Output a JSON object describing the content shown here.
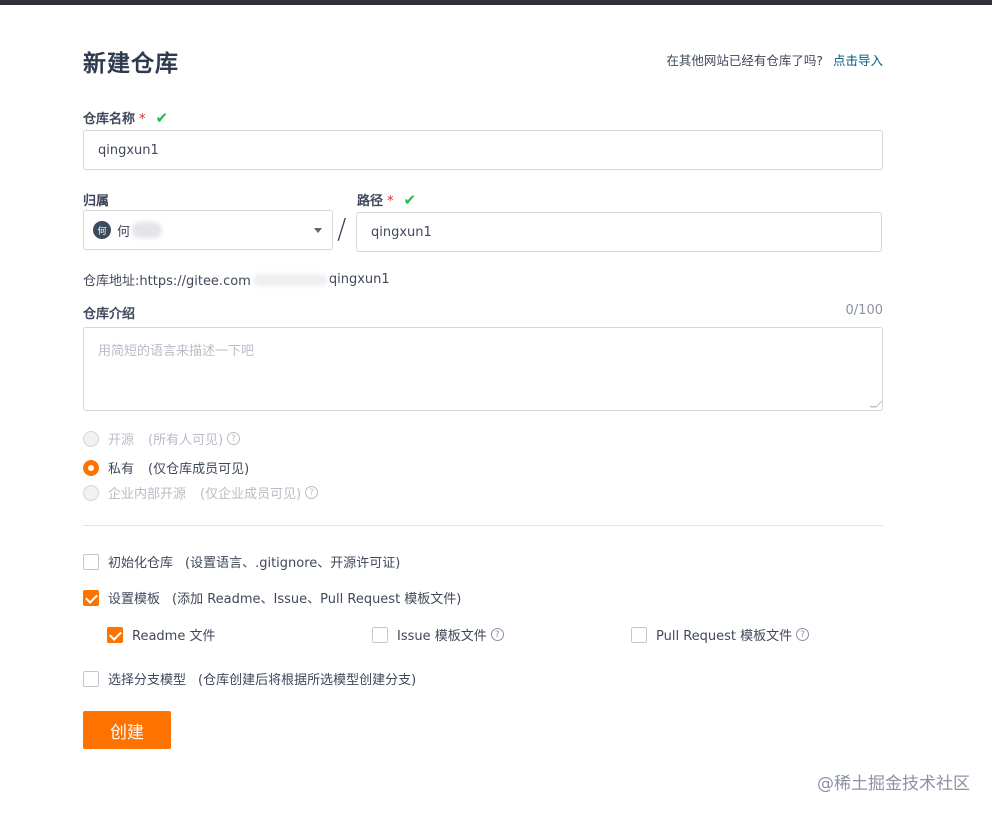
{
  "header": {
    "title": "新建仓库",
    "import_hint": "在其他网站已经有仓库了吗?",
    "import_link": "点击导入"
  },
  "repo_name": {
    "label": "仓库名称",
    "required_mark": "*",
    "valid_mark": "✔",
    "value": "qingxun1"
  },
  "owner": {
    "label": "归属",
    "avatar_text": "何",
    "name": "何"
  },
  "path": {
    "label": "路径",
    "required_mark": "*",
    "valid_mark": "✔",
    "separator": "/",
    "value": "qingxun1"
  },
  "address": {
    "prefix": "仓库地址:https://gitee.com",
    "suffix": "qingxun1"
  },
  "description": {
    "label": "仓库介绍",
    "counter": "0/100",
    "placeholder": "用简短的语言来描述一下吧"
  },
  "visibility": {
    "options": [
      {
        "label": "开源",
        "sub": "(所有人可见)",
        "help": "?"
      },
      {
        "label": "私有",
        "sub": "(仅仓库成员可见)",
        "help": ""
      },
      {
        "label": "企业内部开源",
        "sub": "(仅企业成员可见)",
        "help": "?"
      }
    ],
    "selected_index": 1
  },
  "options": {
    "init": {
      "label": "初始化仓库",
      "sub": "(设置语言、.gitignore、开源许可证)",
      "checked": false
    },
    "template": {
      "label": "设置模板",
      "sub": "(添加 Readme、Issue、Pull Request 模板文件)",
      "checked": true
    },
    "readme": {
      "label": "Readme 文件",
      "checked": true
    },
    "issue": {
      "label": "Issue 模板文件",
      "help": "?",
      "checked": false
    },
    "pr": {
      "label": "Pull Request 模板文件",
      "help": "?",
      "checked": false
    },
    "branch": {
      "label": "选择分支模型",
      "sub": "(仓库创建后将根据所选模型创建分支)",
      "checked": false
    }
  },
  "submit": {
    "label": "创建"
  },
  "watermark": "@稀土掘金技术社区",
  "colors": {
    "accent": "#fe7300",
    "success": "#21ba45",
    "required": "#db2828",
    "link": "#005980"
  }
}
